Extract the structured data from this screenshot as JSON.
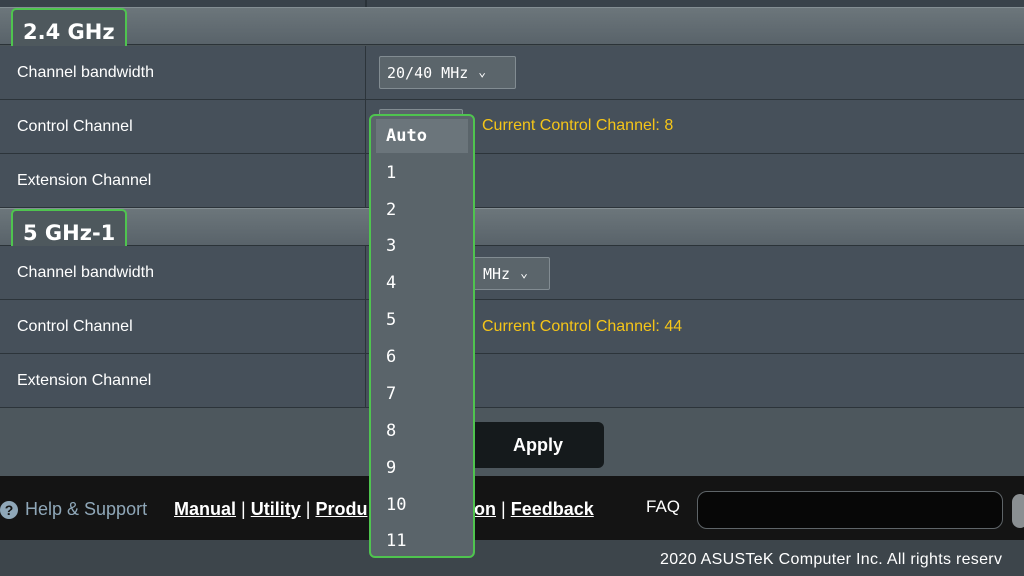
{
  "sections": [
    {
      "title": "2.4 GHz",
      "rows": {
        "bandwidth": {
          "label": "Channel bandwidth",
          "value": "20/40 MHz"
        },
        "control": {
          "label": "Control Channel",
          "hint": "Current Control Channel: 8"
        },
        "extension": {
          "label": "Extension Channel"
        }
      }
    },
    {
      "title": "5 GHz-1",
      "rows": {
        "bandwidth": {
          "label": "Channel bandwidth",
          "value": "MHz"
        },
        "control": {
          "label": "Control Channel",
          "hint": "Current Control Channel: 44"
        },
        "extension": {
          "label": "Extension Channel"
        }
      }
    }
  ],
  "dropdown": {
    "selected": "Auto",
    "options": [
      "Auto",
      "1",
      "2",
      "3",
      "4",
      "5",
      "6",
      "7",
      "8",
      "9",
      "10",
      "11"
    ]
  },
  "apply_label": "Apply",
  "footer": {
    "help_icon": "?",
    "help_label": "Help & Support",
    "links": [
      "Manual",
      "Utility",
      "Produ",
      "on",
      "Feedback"
    ],
    "separator": "|",
    "faq_label": "FAQ",
    "faq_value": "",
    "copyright": "2020 ASUSTeK Computer Inc. All rights reserv"
  },
  "icons": {
    "chevron": "chevron-down-icon",
    "help": "help-circle-icon",
    "search": "search-icon"
  },
  "colors": {
    "accent_highlight": "#4fc44f",
    "hint_text": "#f5c518",
    "help_text": "#8fa7b8"
  }
}
